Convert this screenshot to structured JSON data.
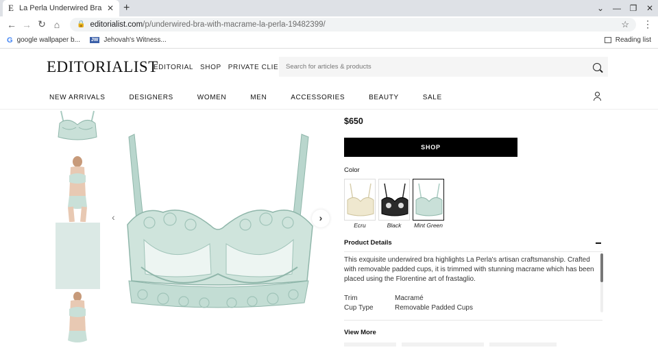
{
  "browser": {
    "tab_favicon": "E",
    "tab_title": "La Perla Underwired Bra With Macrame",
    "url_host": "editorialist.com",
    "url_path": "/p/underwired-bra-with-macrame-la-perla-19482399/",
    "bookmarks": [
      {
        "icon": "G",
        "label": "google wallpaper b..."
      },
      {
        "icon": "JW",
        "label": "Jehovah's Witness..."
      }
    ],
    "reading_list": "Reading list"
  },
  "site": {
    "logo": "EDITORIALIST",
    "top_nav": [
      "EDITORIAL",
      "SHOP",
      "PRIVATE CLIENT"
    ],
    "search_placeholder": "Search for articles & products",
    "categories": [
      "NEW ARRIVALS",
      "DESIGNERS",
      "WOMEN",
      "MEN",
      "ACCESSORIES",
      "BEAUTY",
      "SALE"
    ]
  },
  "product": {
    "price": "$650",
    "shop_label": "SHOP",
    "color_label": "Color",
    "colors": [
      {
        "name": "Ecru",
        "hex": "#efe8cf"
      },
      {
        "name": "Black",
        "hex": "#2a2a2a"
      },
      {
        "name": "Mint Green",
        "hex": "#a9cbc1"
      }
    ],
    "selected_color": "Mint Green",
    "details_title": "Product Details",
    "description": "This exquisite underwired bra highlights La Perla's artisan craftsmanship. Crafted with removable padded cups, it is trimmed with stunning macrame which has been placed using the Florentine art of frastaglio.",
    "specs": [
      {
        "key": "Trim",
        "value": "Macramé"
      },
      {
        "key": "Cup Type",
        "value": "Removable Padded Cups"
      }
    ],
    "view_more": "View More"
  },
  "colors": {
    "mint": "#a9cbc1",
    "mint_dark": "#8fb6aa",
    "black": "#000000"
  }
}
